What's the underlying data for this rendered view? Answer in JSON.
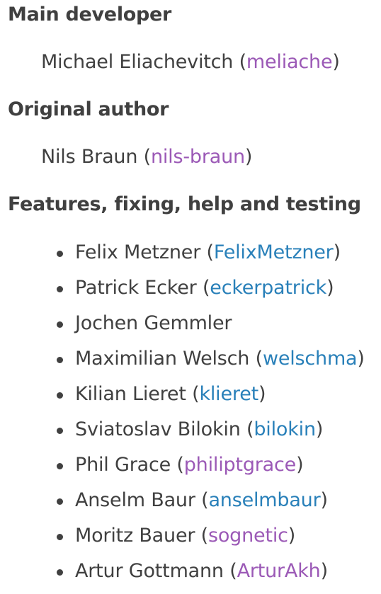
{
  "colors": {
    "text": "#404040",
    "link_visited": "#9b59b6",
    "link": "#2980b9"
  },
  "main_developer": {
    "heading": "Main developer",
    "name": "Michael Eliachevitch",
    "handle": "meliache"
  },
  "original_author": {
    "heading": "Original author",
    "name": "Nils Braun",
    "handle": "nils-braun"
  },
  "contributors": {
    "heading": "Features, fixing, help and testing",
    "items": [
      {
        "name": "Felix Metzner",
        "handle": "FelixMetzner",
        "visited": false
      },
      {
        "name": "Patrick Ecker",
        "handle": "eckerpatrick",
        "visited": false
      },
      {
        "name": "Jochen Gemmler",
        "handle": "",
        "visited": false
      },
      {
        "name": "Maximilian Welsch",
        "handle": "welschma",
        "visited": false
      },
      {
        "name": "Kilian Lieret",
        "handle": "klieret",
        "visited": false
      },
      {
        "name": "Sviatoslav Bilokin",
        "handle": "bilokin",
        "visited": false
      },
      {
        "name": "Phil Grace",
        "handle": "philiptgrace",
        "visited": true
      },
      {
        "name": "Anselm Baur",
        "handle": "anselmbaur",
        "visited": false
      },
      {
        "name": "Moritz Bauer",
        "handle": "sognetic",
        "visited": true
      },
      {
        "name": "Artur Gottmann",
        "handle": "ArturAkh",
        "visited": true
      }
    ]
  }
}
